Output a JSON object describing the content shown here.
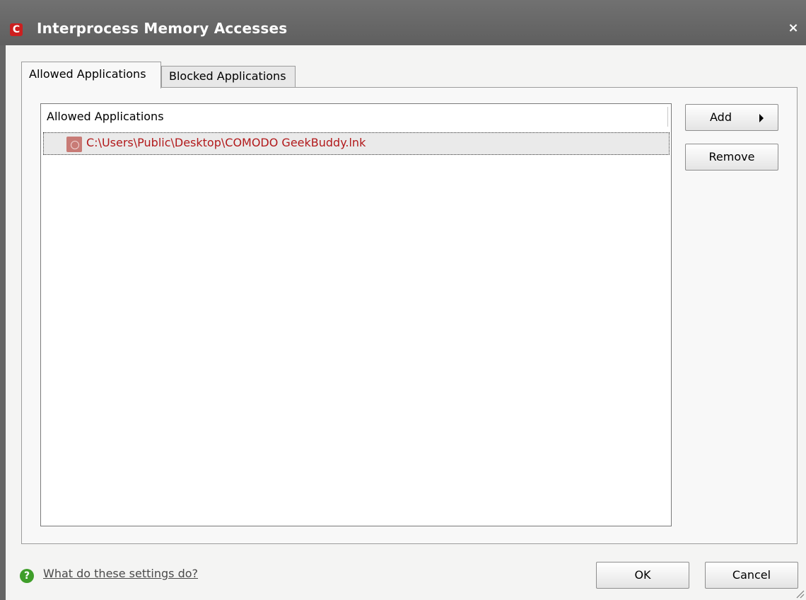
{
  "window": {
    "title": "Interprocess Memory Accesses",
    "close_label": "×",
    "logo_letter": "C"
  },
  "tabs": [
    {
      "label": "Allowed Applications",
      "active": true
    },
    {
      "label": "Blocked Applications",
      "active": false
    }
  ],
  "list": {
    "column_header": "Allowed Applications",
    "rows": [
      {
        "path": "C:\\Users\\Public\\Desktop\\COMODO GeekBuddy.lnk",
        "icon": "shortcut-icon"
      }
    ]
  },
  "buttons": {
    "add": "Add",
    "remove": "Remove",
    "ok": "OK",
    "cancel": "Cancel"
  },
  "help": {
    "icon_glyph": "?",
    "link": "What do these settings do?"
  },
  "colors": {
    "titlebar": "#666666",
    "row_text": "#b2191b",
    "help_icon": "#3f9e2a",
    "logo": "#cc1f1f"
  }
}
